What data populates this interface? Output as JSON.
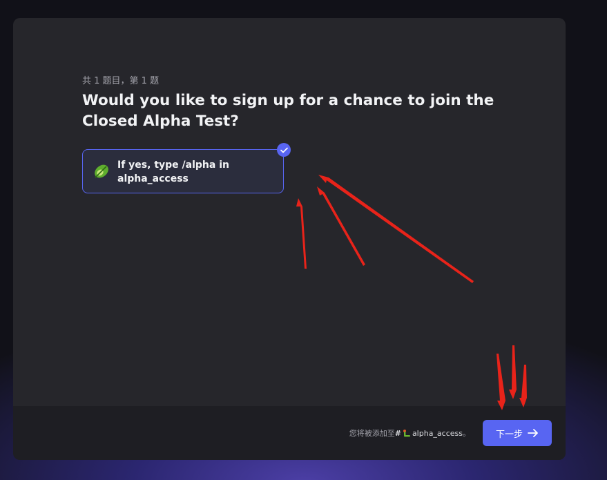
{
  "question": {
    "progress": "共 1 题目，第 1 题",
    "title": "Would you like to sign up for a chance to join the Closed Alpha Test?"
  },
  "option": {
    "label": "If yes, type /alpha in alpha_access",
    "emoji": "leaf-icon",
    "selected": true
  },
  "footer": {
    "note_prefix": "您将被添加至",
    "channel_hash": "#",
    "channel_name": "alpha_access",
    "note_suffix": "。",
    "next_label": "下一步"
  },
  "colors": {
    "accent": "#5865f2",
    "annotation": "#e8231a"
  }
}
